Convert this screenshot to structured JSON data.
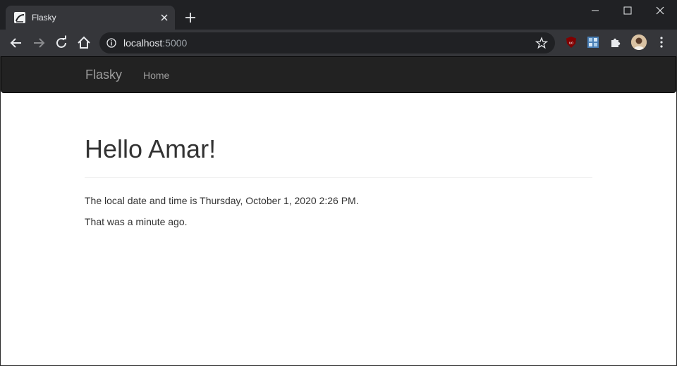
{
  "browser": {
    "tab_title": "Flasky",
    "url_host": "localhost",
    "url_port": ":5000"
  },
  "navbar": {
    "brand": "Flasky",
    "home_label": "Home"
  },
  "main": {
    "heading": "Hello Amar!",
    "local_time_text": "The local date and time is Thursday, October 1, 2020 2:26 PM.",
    "relative_time_text": "That was a minute ago."
  },
  "colors": {
    "navbar_bg": "#222222",
    "navbar_text": "#9d9d9d",
    "body_text": "#333333",
    "chrome_frame": "#202124",
    "chrome_toolbar": "#35363a"
  }
}
